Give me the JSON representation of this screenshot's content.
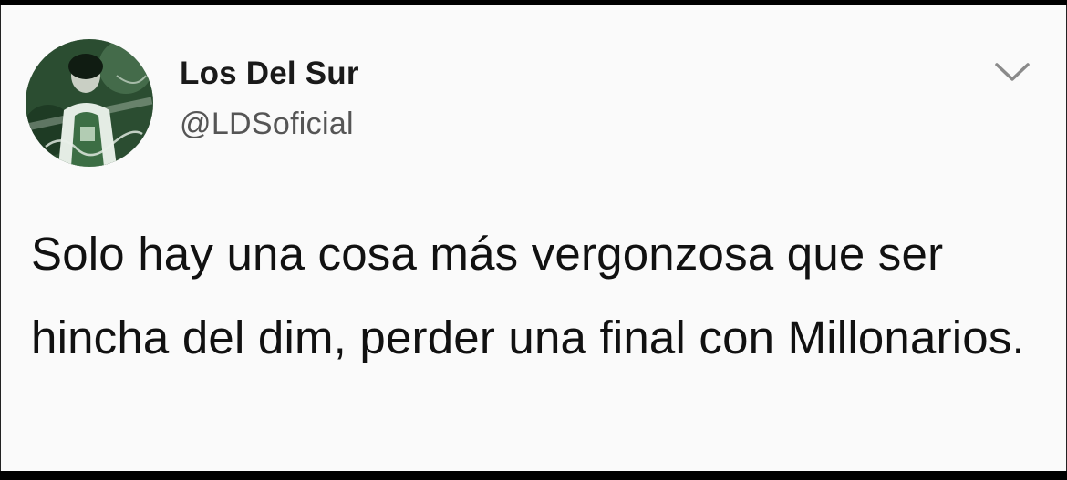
{
  "tweet": {
    "author": {
      "display_name": "Los Del Sur",
      "handle": "@LDSoficial",
      "avatar_icon": "profile-avatar"
    },
    "menu_icon": "chevron-down-icon",
    "text": "Solo hay una cosa más vergonzosa que ser hincha del dim, perder una final con Millonarios."
  },
  "colors": {
    "background": "#fafafa",
    "frame": "#000000",
    "text": "#111111",
    "handle": "#555555",
    "avatar_green": "#2e5a36"
  }
}
